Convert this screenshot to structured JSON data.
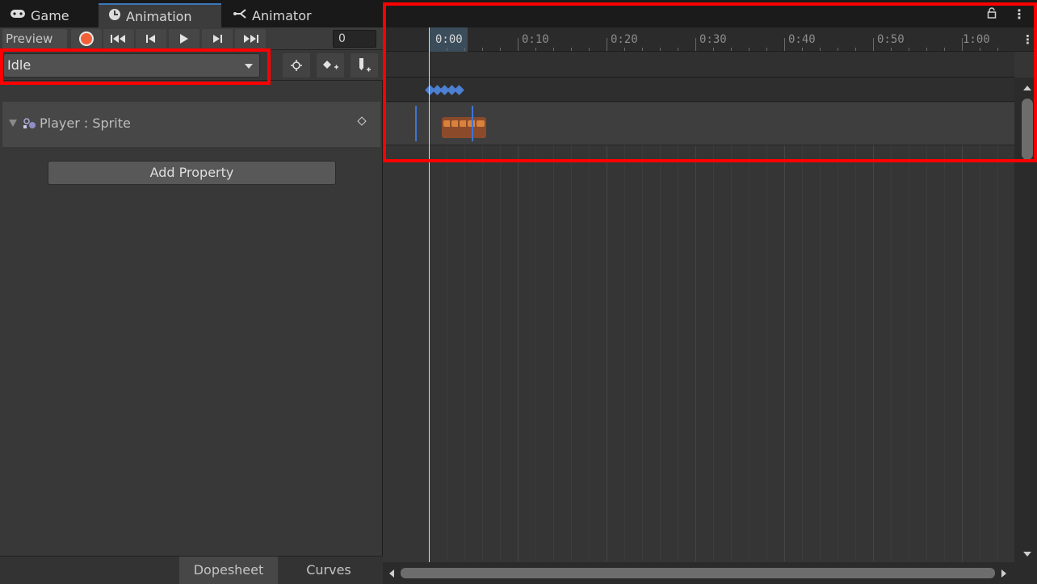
{
  "tabs": [
    {
      "label": "Game",
      "icon": "gamepad-icon"
    },
    {
      "label": "Animation",
      "icon": "clock-icon"
    },
    {
      "label": "Animator",
      "icon": "animator-icon"
    }
  ],
  "toolbar": {
    "preview_label": "Preview",
    "frame_value": "0"
  },
  "clip": {
    "selected": "Idle"
  },
  "properties": [
    {
      "label": "Player : Sprite"
    }
  ],
  "add_property_label": "Add Property",
  "bottom_tabs": {
    "dopesheet": "Dopesheet",
    "curves": "Curves"
  },
  "timeline": {
    "ticks": [
      "0:00",
      "0:10",
      "0:20",
      "0:30",
      "0:40",
      "0:50",
      "1:00"
    ]
  },
  "colors": {
    "accent_blue": "#3f74d4",
    "record_orange": "#f26038",
    "annotation_red": "#ff0000"
  }
}
